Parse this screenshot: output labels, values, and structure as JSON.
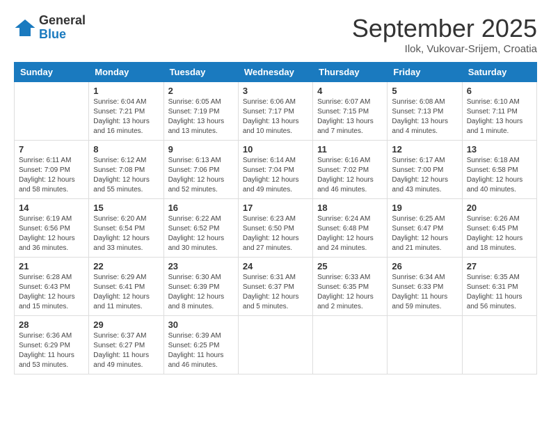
{
  "logo": {
    "general": "General",
    "blue": "Blue"
  },
  "title": "September 2025",
  "location": "Ilok, Vukovar-Srijem, Croatia",
  "headers": [
    "Sunday",
    "Monday",
    "Tuesday",
    "Wednesday",
    "Thursday",
    "Friday",
    "Saturday"
  ],
  "weeks": [
    [
      {
        "day": "",
        "sunrise": "",
        "sunset": "",
        "daylight": ""
      },
      {
        "day": "1",
        "sunrise": "Sunrise: 6:04 AM",
        "sunset": "Sunset: 7:21 PM",
        "daylight": "Daylight: 13 hours and 16 minutes."
      },
      {
        "day": "2",
        "sunrise": "Sunrise: 6:05 AM",
        "sunset": "Sunset: 7:19 PM",
        "daylight": "Daylight: 13 hours and 13 minutes."
      },
      {
        "day": "3",
        "sunrise": "Sunrise: 6:06 AM",
        "sunset": "Sunset: 7:17 PM",
        "daylight": "Daylight: 13 hours and 10 minutes."
      },
      {
        "day": "4",
        "sunrise": "Sunrise: 6:07 AM",
        "sunset": "Sunset: 7:15 PM",
        "daylight": "Daylight: 13 hours and 7 minutes."
      },
      {
        "day": "5",
        "sunrise": "Sunrise: 6:08 AM",
        "sunset": "Sunset: 7:13 PM",
        "daylight": "Daylight: 13 hours and 4 minutes."
      },
      {
        "day": "6",
        "sunrise": "Sunrise: 6:10 AM",
        "sunset": "Sunset: 7:11 PM",
        "daylight": "Daylight: 13 hours and 1 minute."
      }
    ],
    [
      {
        "day": "7",
        "sunrise": "Sunrise: 6:11 AM",
        "sunset": "Sunset: 7:09 PM",
        "daylight": "Daylight: 12 hours and 58 minutes."
      },
      {
        "day": "8",
        "sunrise": "Sunrise: 6:12 AM",
        "sunset": "Sunset: 7:08 PM",
        "daylight": "Daylight: 12 hours and 55 minutes."
      },
      {
        "day": "9",
        "sunrise": "Sunrise: 6:13 AM",
        "sunset": "Sunset: 7:06 PM",
        "daylight": "Daylight: 12 hours and 52 minutes."
      },
      {
        "day": "10",
        "sunrise": "Sunrise: 6:14 AM",
        "sunset": "Sunset: 7:04 PM",
        "daylight": "Daylight: 12 hours and 49 minutes."
      },
      {
        "day": "11",
        "sunrise": "Sunrise: 6:16 AM",
        "sunset": "Sunset: 7:02 PM",
        "daylight": "Daylight: 12 hours and 46 minutes."
      },
      {
        "day": "12",
        "sunrise": "Sunrise: 6:17 AM",
        "sunset": "Sunset: 7:00 PM",
        "daylight": "Daylight: 12 hours and 43 minutes."
      },
      {
        "day": "13",
        "sunrise": "Sunrise: 6:18 AM",
        "sunset": "Sunset: 6:58 PM",
        "daylight": "Daylight: 12 hours and 40 minutes."
      }
    ],
    [
      {
        "day": "14",
        "sunrise": "Sunrise: 6:19 AM",
        "sunset": "Sunset: 6:56 PM",
        "daylight": "Daylight: 12 hours and 36 minutes."
      },
      {
        "day": "15",
        "sunrise": "Sunrise: 6:20 AM",
        "sunset": "Sunset: 6:54 PM",
        "daylight": "Daylight: 12 hours and 33 minutes."
      },
      {
        "day": "16",
        "sunrise": "Sunrise: 6:22 AM",
        "sunset": "Sunset: 6:52 PM",
        "daylight": "Daylight: 12 hours and 30 minutes."
      },
      {
        "day": "17",
        "sunrise": "Sunrise: 6:23 AM",
        "sunset": "Sunset: 6:50 PM",
        "daylight": "Daylight: 12 hours and 27 minutes."
      },
      {
        "day": "18",
        "sunrise": "Sunrise: 6:24 AM",
        "sunset": "Sunset: 6:48 PM",
        "daylight": "Daylight: 12 hours and 24 minutes."
      },
      {
        "day": "19",
        "sunrise": "Sunrise: 6:25 AM",
        "sunset": "Sunset: 6:47 PM",
        "daylight": "Daylight: 12 hours and 21 minutes."
      },
      {
        "day": "20",
        "sunrise": "Sunrise: 6:26 AM",
        "sunset": "Sunset: 6:45 PM",
        "daylight": "Daylight: 12 hours and 18 minutes."
      }
    ],
    [
      {
        "day": "21",
        "sunrise": "Sunrise: 6:28 AM",
        "sunset": "Sunset: 6:43 PM",
        "daylight": "Daylight: 12 hours and 15 minutes."
      },
      {
        "day": "22",
        "sunrise": "Sunrise: 6:29 AM",
        "sunset": "Sunset: 6:41 PM",
        "daylight": "Daylight: 12 hours and 11 minutes."
      },
      {
        "day": "23",
        "sunrise": "Sunrise: 6:30 AM",
        "sunset": "Sunset: 6:39 PM",
        "daylight": "Daylight: 12 hours and 8 minutes."
      },
      {
        "day": "24",
        "sunrise": "Sunrise: 6:31 AM",
        "sunset": "Sunset: 6:37 PM",
        "daylight": "Daylight: 12 hours and 5 minutes."
      },
      {
        "day": "25",
        "sunrise": "Sunrise: 6:33 AM",
        "sunset": "Sunset: 6:35 PM",
        "daylight": "Daylight: 12 hours and 2 minutes."
      },
      {
        "day": "26",
        "sunrise": "Sunrise: 6:34 AM",
        "sunset": "Sunset: 6:33 PM",
        "daylight": "Daylight: 11 hours and 59 minutes."
      },
      {
        "day": "27",
        "sunrise": "Sunrise: 6:35 AM",
        "sunset": "Sunset: 6:31 PM",
        "daylight": "Daylight: 11 hours and 56 minutes."
      }
    ],
    [
      {
        "day": "28",
        "sunrise": "Sunrise: 6:36 AM",
        "sunset": "Sunset: 6:29 PM",
        "daylight": "Daylight: 11 hours and 53 minutes."
      },
      {
        "day": "29",
        "sunrise": "Sunrise: 6:37 AM",
        "sunset": "Sunset: 6:27 PM",
        "daylight": "Daylight: 11 hours and 49 minutes."
      },
      {
        "day": "30",
        "sunrise": "Sunrise: 6:39 AM",
        "sunset": "Sunset: 6:25 PM",
        "daylight": "Daylight: 11 hours and 46 minutes."
      },
      {
        "day": "",
        "sunrise": "",
        "sunset": "",
        "daylight": ""
      },
      {
        "day": "",
        "sunrise": "",
        "sunset": "",
        "daylight": ""
      },
      {
        "day": "",
        "sunrise": "",
        "sunset": "",
        "daylight": ""
      },
      {
        "day": "",
        "sunrise": "",
        "sunset": "",
        "daylight": ""
      }
    ]
  ]
}
